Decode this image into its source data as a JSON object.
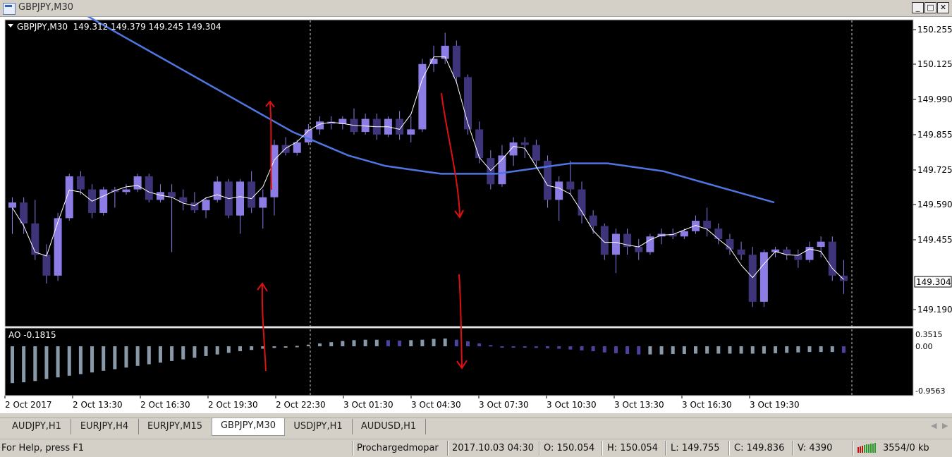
{
  "window": {
    "title": "GBPJPY,M30",
    "minimize": "_",
    "maximize": "□",
    "close": "✕"
  },
  "chart": {
    "header_label": "GBPJPY,M30  149.312 149.379 149.245 149.304",
    "current_price": "149.304",
    "price_axis_labels": [
      "150.255",
      "150.125",
      "149.990",
      "149.855",
      "149.725",
      "149.590",
      "149.455",
      "149.190"
    ],
    "time_axis_labels": [
      "2 Oct 2017",
      "2 Oct 13:30",
      "2 Oct 16:30",
      "2 Oct 19:30",
      "2 Oct 22:30",
      "3 Oct 01:30",
      "3 Oct 04:30",
      "3 Oct 07:30",
      "3 Oct 10:30",
      "3 Oct 13:30",
      "3 Oct 16:30",
      "3 Oct 19:30"
    ],
    "colors": {
      "background": "#000000",
      "bull_candle": "#8c7ce6",
      "bear_candle": "#3d347a",
      "wick": "#8c7ce6",
      "moving_average": "#4f76e0",
      "fast_line": "#ffffff",
      "ao_gray": "#8899aa",
      "ao_blue": "#4a44a0",
      "annotation_arrows": "#e01010",
      "grid": "#c8c8c8"
    }
  },
  "indicator": {
    "label": "AO -0.1815",
    "axis_labels": [
      "0.3515",
      "0.00",
      "-0.9563"
    ]
  },
  "tabs": [
    {
      "label": "AUDJPY,H1"
    },
    {
      "label": "EURJPY,H4"
    },
    {
      "label": "EURJPY,M15"
    },
    {
      "label": "GBPJPY,M30",
      "active": true
    },
    {
      "label": "USDJPY,H1"
    },
    {
      "label": "AUDUSD,H1"
    }
  ],
  "status": {
    "help": "For Help, press F1",
    "profile": "Prochargedmopar",
    "datetime": "2017.10.03 04:30",
    "open": "O: 150.054",
    "high": "H: 150.054",
    "low": "L: 149.755",
    "close": "C: 149.836",
    "volume": "V: 4390",
    "traffic": "3554/0 kb"
  },
  "chart_data": {
    "type": "candlestick",
    "symbol": "GBPJPY",
    "timeframe": "M30",
    "ylim": [
      149.1,
      150.3
    ],
    "candles": [
      {
        "o": 149.58,
        "h": 149.62,
        "l": 149.48,
        "c": 149.6
      },
      {
        "o": 149.6,
        "h": 149.62,
        "l": 149.48,
        "c": 149.52
      },
      {
        "o": 149.52,
        "h": 149.61,
        "l": 149.38,
        "c": 149.4
      },
      {
        "o": 149.4,
        "h": 149.44,
        "l": 149.29,
        "c": 149.32
      },
      {
        "o": 149.32,
        "h": 149.56,
        "l": 149.3,
        "c": 149.54
      },
      {
        "o": 149.54,
        "h": 149.71,
        "l": 149.53,
        "c": 149.7
      },
      {
        "o": 149.7,
        "h": 149.72,
        "l": 149.63,
        "c": 149.65
      },
      {
        "o": 149.65,
        "h": 149.67,
        "l": 149.54,
        "c": 149.56
      },
      {
        "o": 149.56,
        "h": 149.66,
        "l": 149.55,
        "c": 149.65
      },
      {
        "o": 149.65,
        "h": 149.66,
        "l": 149.58,
        "c": 149.64
      },
      {
        "o": 149.64,
        "h": 149.67,
        "l": 149.63,
        "c": 149.65
      },
      {
        "o": 149.65,
        "h": 149.71,
        "l": 149.64,
        "c": 149.7
      },
      {
        "o": 149.7,
        "h": 149.71,
        "l": 149.6,
        "c": 149.61
      },
      {
        "o": 149.61,
        "h": 149.67,
        "l": 149.6,
        "c": 149.64
      },
      {
        "o": 149.64,
        "h": 149.67,
        "l": 149.41,
        "c": 149.62
      },
      {
        "o": 149.62,
        "h": 149.65,
        "l": 149.57,
        "c": 149.6
      },
      {
        "o": 149.6,
        "h": 149.64,
        "l": 149.56,
        "c": 149.57
      },
      {
        "o": 149.57,
        "h": 149.62,
        "l": 149.54,
        "c": 149.61
      },
      {
        "o": 149.61,
        "h": 149.7,
        "l": 149.6,
        "c": 149.68
      },
      {
        "o": 149.68,
        "h": 149.69,
        "l": 149.54,
        "c": 149.55
      },
      {
        "o": 149.55,
        "h": 149.69,
        "l": 149.48,
        "c": 149.68
      },
      {
        "o": 149.68,
        "h": 149.72,
        "l": 149.56,
        "c": 149.58
      },
      {
        "o": 149.58,
        "h": 149.65,
        "l": 149.5,
        "c": 149.62
      },
      {
        "o": 149.62,
        "h": 149.84,
        "l": 149.55,
        "c": 149.82
      },
      {
        "o": 149.82,
        "h": 149.85,
        "l": 149.78,
        "c": 149.79
      },
      {
        "o": 149.79,
        "h": 149.84,
        "l": 149.78,
        "c": 149.83
      },
      {
        "o": 149.83,
        "h": 149.9,
        "l": 149.82,
        "c": 149.88
      },
      {
        "o": 149.88,
        "h": 149.93,
        "l": 149.86,
        "c": 149.91
      },
      {
        "o": 149.91,
        "h": 149.93,
        "l": 149.88,
        "c": 149.9
      },
      {
        "o": 149.9,
        "h": 149.93,
        "l": 149.88,
        "c": 149.92
      },
      {
        "o": 149.92,
        "h": 149.96,
        "l": 149.86,
        "c": 149.87
      },
      {
        "o": 149.87,
        "h": 149.94,
        "l": 149.86,
        "c": 149.92
      },
      {
        "o": 149.92,
        "h": 149.94,
        "l": 149.84,
        "c": 149.86
      },
      {
        "o": 149.86,
        "h": 149.93,
        "l": 149.85,
        "c": 149.92
      },
      {
        "o": 149.92,
        "h": 149.95,
        "l": 149.84,
        "c": 149.86
      },
      {
        "o": 149.86,
        "h": 149.93,
        "l": 149.83,
        "c": 149.88
      },
      {
        "o": 149.88,
        "h": 150.15,
        "l": 149.87,
        "c": 150.13
      },
      {
        "o": 150.13,
        "h": 150.2,
        "l": 150.1,
        "c": 150.15
      },
      {
        "o": 150.15,
        "h": 150.25,
        "l": 150.13,
        "c": 150.2
      },
      {
        "o": 150.2,
        "h": 150.22,
        "l": 150.06,
        "c": 150.08
      },
      {
        "o": 150.08,
        "h": 150.09,
        "l": 149.86,
        "c": 149.88
      },
      {
        "o": 149.88,
        "h": 149.91,
        "l": 149.75,
        "c": 149.77
      },
      {
        "o": 149.77,
        "h": 149.8,
        "l": 149.65,
        "c": 149.67
      },
      {
        "o": 149.67,
        "h": 149.82,
        "l": 149.66,
        "c": 149.78
      },
      {
        "o": 149.78,
        "h": 149.85,
        "l": 149.74,
        "c": 149.83
      },
      {
        "o": 149.83,
        "h": 149.85,
        "l": 149.77,
        "c": 149.82
      },
      {
        "o": 149.82,
        "h": 149.84,
        "l": 149.73,
        "c": 149.76
      },
      {
        "o": 149.76,
        "h": 149.78,
        "l": 149.58,
        "c": 149.61
      },
      {
        "o": 149.61,
        "h": 149.7,
        "l": 149.53,
        "c": 149.68
      },
      {
        "o": 149.68,
        "h": 149.76,
        "l": 149.63,
        "c": 149.65
      },
      {
        "o": 149.65,
        "h": 149.68,
        "l": 149.52,
        "c": 149.55
      },
      {
        "o": 149.55,
        "h": 149.57,
        "l": 149.48,
        "c": 149.51
      },
      {
        "o": 149.51,
        "h": 149.52,
        "l": 149.38,
        "c": 149.4
      },
      {
        "o": 149.4,
        "h": 149.5,
        "l": 149.33,
        "c": 149.48
      },
      {
        "o": 149.48,
        "h": 149.5,
        "l": 149.4,
        "c": 149.43
      },
      {
        "o": 149.43,
        "h": 149.46,
        "l": 149.38,
        "c": 149.41
      },
      {
        "o": 149.41,
        "h": 149.48,
        "l": 149.4,
        "c": 149.47
      },
      {
        "o": 149.47,
        "h": 149.5,
        "l": 149.44,
        "c": 149.48
      },
      {
        "o": 149.48,
        "h": 149.5,
        "l": 149.46,
        "c": 149.47
      },
      {
        "o": 149.47,
        "h": 149.5,
        "l": 149.46,
        "c": 149.49
      },
      {
        "o": 149.49,
        "h": 149.55,
        "l": 149.48,
        "c": 149.53
      },
      {
        "o": 149.53,
        "h": 149.58,
        "l": 149.47,
        "c": 149.5
      },
      {
        "o": 149.5,
        "h": 149.52,
        "l": 149.44,
        "c": 149.46
      },
      {
        "o": 149.46,
        "h": 149.48,
        "l": 149.4,
        "c": 149.42
      },
      {
        "o": 149.42,
        "h": 149.45,
        "l": 149.38,
        "c": 149.4
      },
      {
        "o": 149.4,
        "h": 149.43,
        "l": 149.2,
        "c": 149.22
      },
      {
        "o": 149.22,
        "h": 149.42,
        "l": 149.2,
        "c": 149.41
      },
      {
        "o": 149.41,
        "h": 149.43,
        "l": 149.39,
        "c": 149.42
      },
      {
        "o": 149.42,
        "h": 149.43,
        "l": 149.38,
        "c": 149.4
      },
      {
        "o": 149.4,
        "h": 149.42,
        "l": 149.35,
        "c": 149.38
      },
      {
        "o": 149.38,
        "h": 149.45,
        "l": 149.37,
        "c": 149.43
      },
      {
        "o": 149.43,
        "h": 149.47,
        "l": 149.39,
        "c": 149.45
      },
      {
        "o": 149.45,
        "h": 149.47,
        "l": 149.3,
        "c": 149.32
      },
      {
        "o": 149.32,
        "h": 149.38,
        "l": 149.25,
        "c": 149.3
      }
    ],
    "ao": [
      -0.9,
      -0.88,
      -0.85,
      -0.8,
      -0.76,
      -0.72,
      -0.68,
      -0.64,
      -0.6,
      -0.56,
      -0.52,
      -0.48,
      -0.44,
      -0.4,
      -0.36,
      -0.32,
      -0.28,
      -0.24,
      -0.2,
      -0.16,
      -0.12,
      -0.09,
      -0.06,
      -0.04,
      -0.02,
      0.01,
      0.04,
      0.07,
      0.1,
      0.13,
      0.15,
      0.16,
      0.16,
      0.15,
      0.14,
      0.15,
      0.16,
      0.18,
      0.19,
      0.16,
      0.12,
      0.07,
      0.03,
      0.0,
      -0.02,
      -0.03,
      -0.04,
      -0.05,
      -0.06,
      -0.08,
      -0.1,
      -0.12,
      -0.15,
      -0.17,
      -0.19,
      -0.2,
      -0.2,
      -0.2,
      -0.19,
      -0.19,
      -0.18,
      -0.18,
      -0.18,
      -0.18,
      -0.18,
      -0.18,
      -0.18,
      -0.17,
      -0.16,
      -0.15,
      -0.14,
      -0.14,
      -0.14,
      -0.16
    ],
    "ma_slow": [
      150.35,
      150.31,
      150.27,
      150.23,
      150.19,
      150.15,
      150.11,
      150.07,
      150.03,
      149.99,
      149.95,
      149.91,
      149.87,
      149.84,
      149.81,
      149.78,
      149.76,
      149.74,
      149.73,
      149.72,
      149.71,
      149.71,
      149.71,
      149.71,
      149.72,
      149.73,
      149.74,
      149.75,
      149.75,
      149.75,
      149.74,
      149.73,
      149.72,
      149.7,
      149.68,
      149.66,
      149.64,
      149.62,
      149.6
    ],
    "indicator": {
      "name": "AO",
      "value": -0.1815
    }
  }
}
